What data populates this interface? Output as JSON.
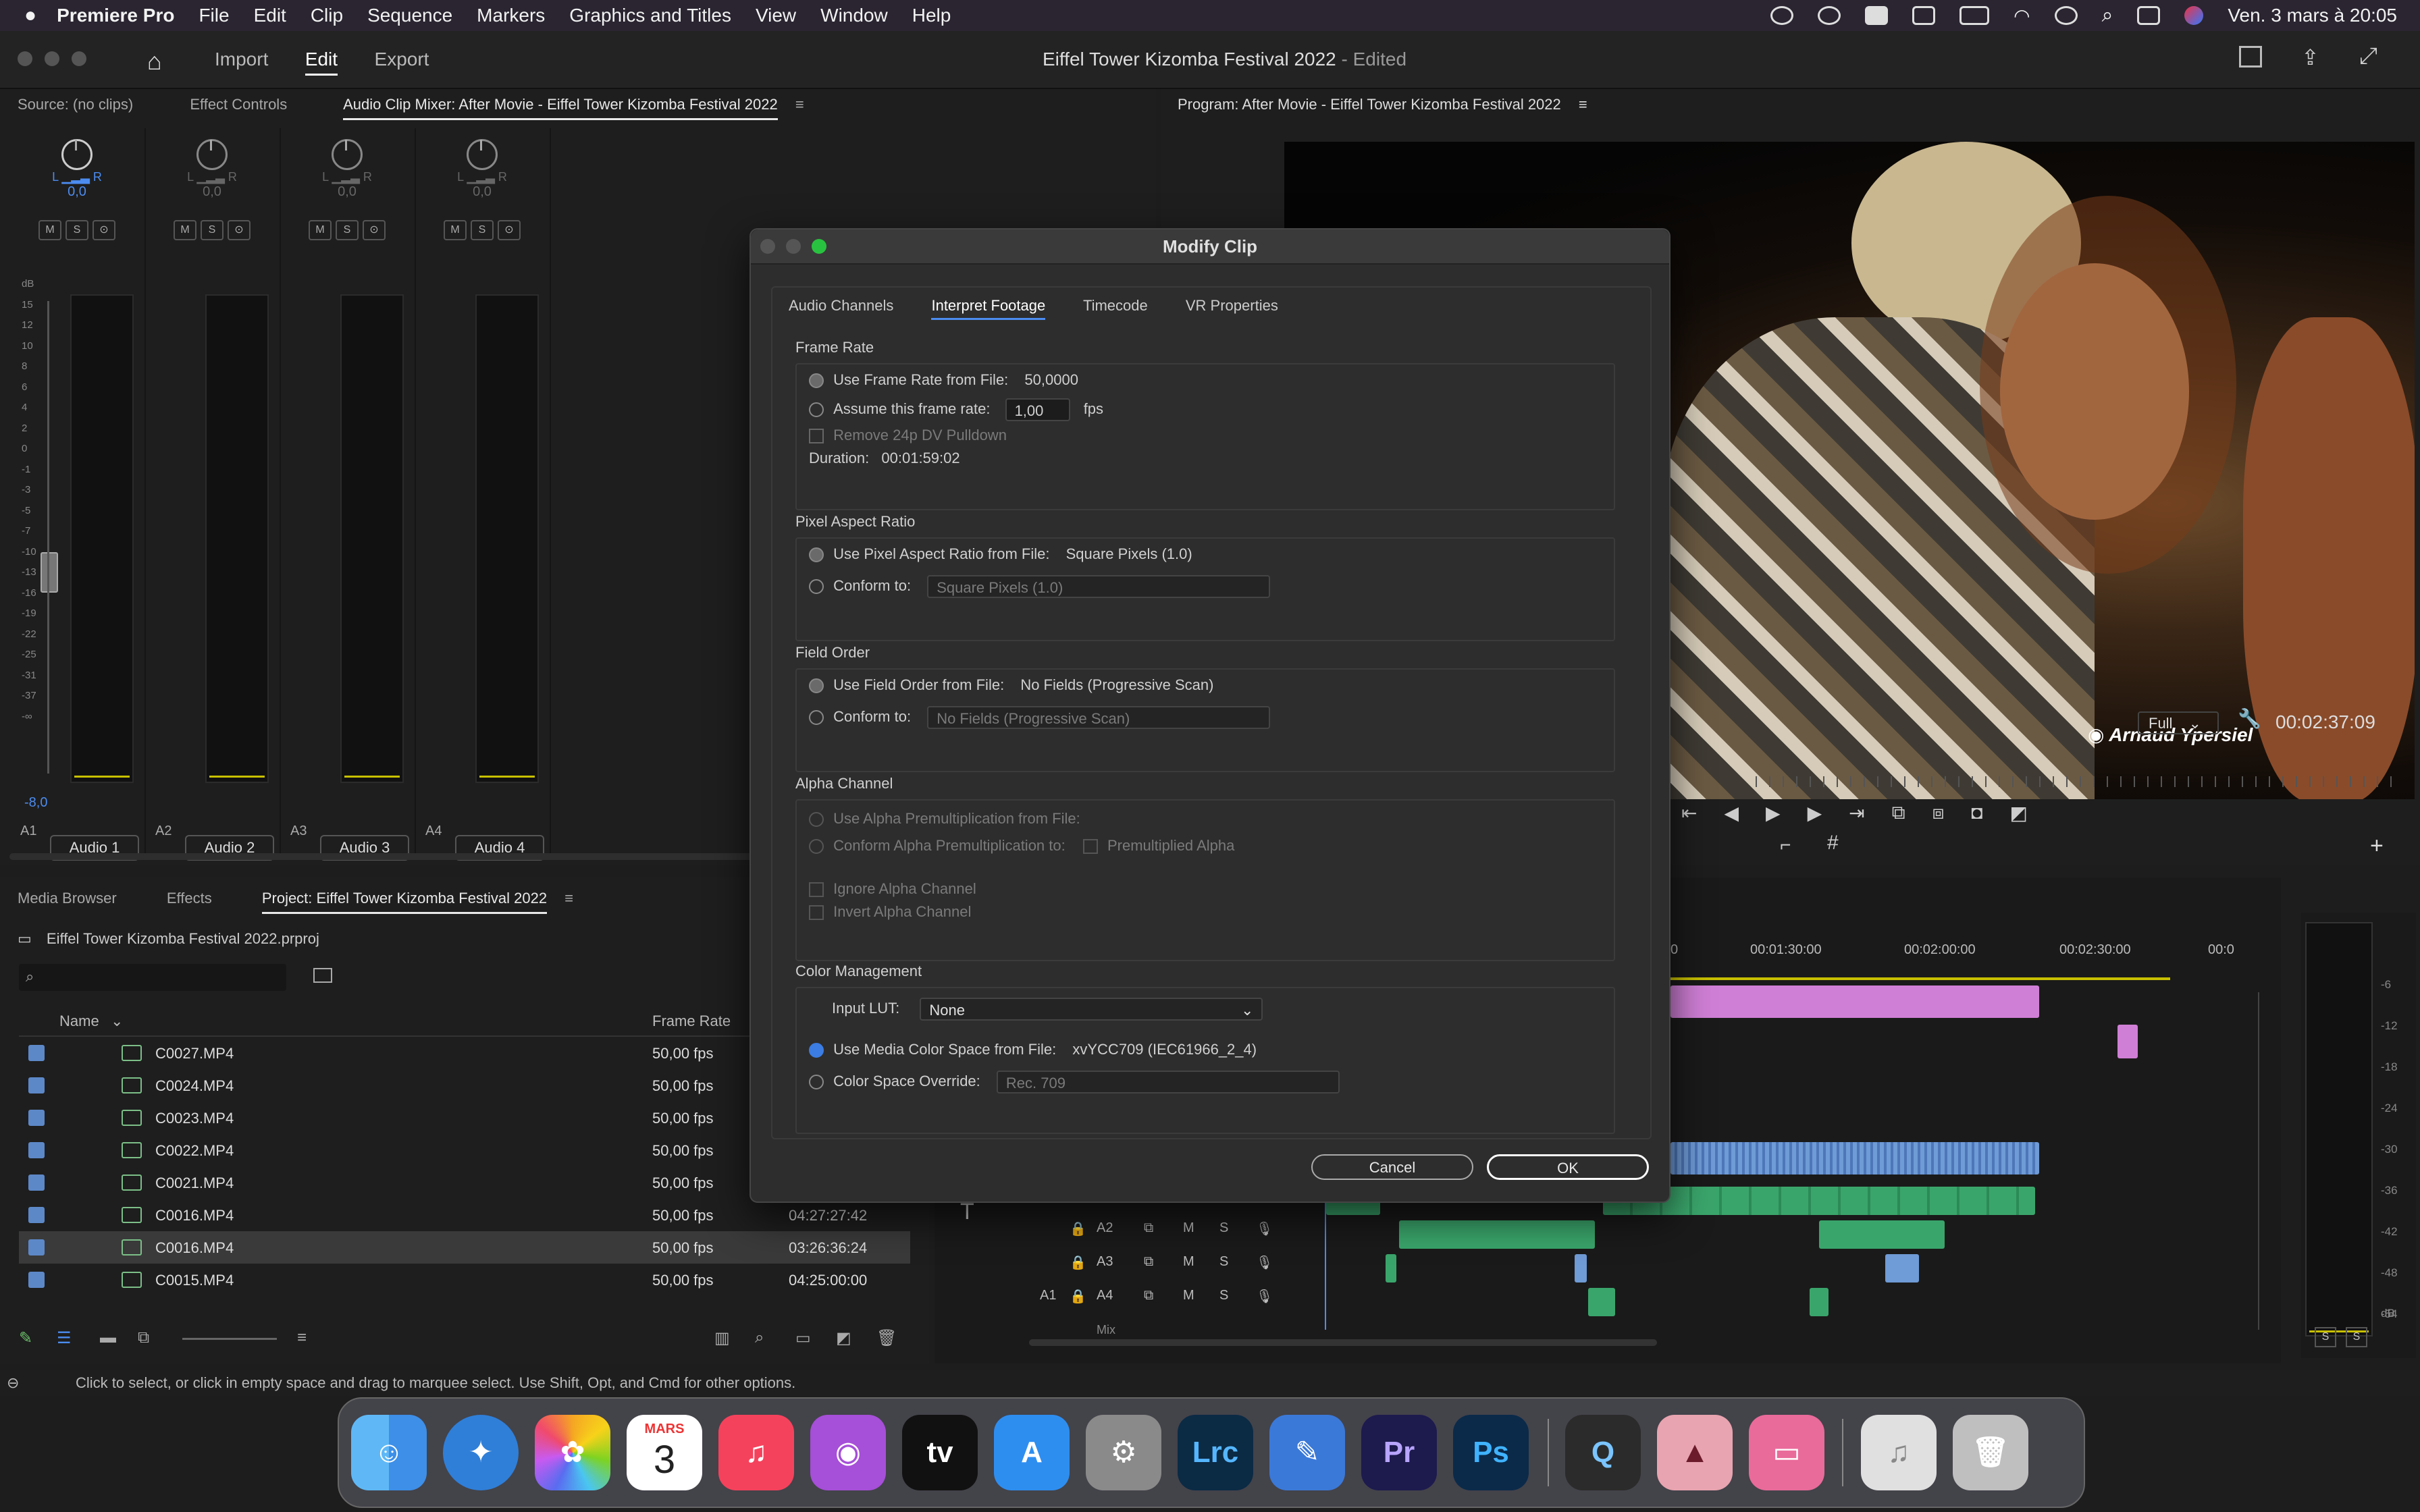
{
  "menubar": {
    "app_name": "Premiere Pro",
    "items": [
      "File",
      "Edit",
      "Clip",
      "Sequence",
      "Markers",
      "Graphics and Titles",
      "View",
      "Window",
      "Help"
    ],
    "clock": "Ven. 3 mars à 20:05"
  },
  "header": {
    "workspaces": [
      "Import",
      "Edit",
      "Export"
    ],
    "active_workspace": "Edit",
    "project_title": "Eiffel Tower Kizomba Festival 2022",
    "edited_suffix": " - Edited"
  },
  "source_panel": {
    "tabs": [
      "Source: (no clips)",
      "Effect Controls",
      "Audio Clip Mixer: After Movie - Eiffel Tower Kizomba Festival 2022"
    ],
    "channels": [
      {
        "id": "A1",
        "name": "Audio 1",
        "pan": "0,0",
        "level": "-8,0"
      },
      {
        "id": "A2",
        "name": "Audio 2",
        "pan": "0,0",
        "level": ""
      },
      {
        "id": "A3",
        "name": "Audio 3",
        "pan": "0,0",
        "level": ""
      },
      {
        "id": "A4",
        "name": "Audio 4",
        "pan": "0,0",
        "level": ""
      }
    ],
    "msb": [
      "M",
      "S",
      "⊙"
    ],
    "db_scale": [
      "dB",
      "15",
      "12",
      "10",
      "8",
      "6",
      "4",
      "2",
      "0",
      "-1",
      "-3",
      "-5",
      "-7",
      "-10",
      "-13",
      "-16",
      "-19",
      "-22",
      "-25",
      "-31",
      "-37",
      "-∞"
    ]
  },
  "program_panel": {
    "title": "Program: After Movie - Eiffel Tower Kizomba Festival 2022",
    "watermark": "Arnaud Ypersiel",
    "zoom": "Full",
    "timecode": "00:02:37:09"
  },
  "project_panel": {
    "tabs": [
      "Media Browser",
      "Effects",
      "Project: Eiffel Tower Kizomba Festival 2022"
    ],
    "file": "Eiffel Tower Kizomba Festival 2022.prproj",
    "columns": {
      "name": "Name",
      "frame_rate": "Frame Rate"
    },
    "rows": [
      {
        "name": "C0027.MP4",
        "fps": "50,00 fps",
        "dur": ""
      },
      {
        "name": "C0024.MP4",
        "fps": "50,00 fps",
        "dur": ""
      },
      {
        "name": "C0023.MP4",
        "fps": "50,00 fps",
        "dur": ""
      },
      {
        "name": "C0022.MP4",
        "fps": "50,00 fps",
        "dur": ""
      },
      {
        "name": "C0021.MP4",
        "fps": "50,00 fps",
        "dur": ""
      },
      {
        "name": "C0016.MP4",
        "fps": "50,00 fps",
        "dur": "04:27:27:42"
      },
      {
        "name": "C0016.MP4",
        "fps": "50,00 fps",
        "dur": "03:26:36:24"
      },
      {
        "name": "C0015.MP4",
        "fps": "50,00 fps",
        "dur": "04:25:00:00"
      }
    ]
  },
  "timeline": {
    "ruler": [
      "0",
      "00:01:30:00",
      "00:02:00:00",
      "00:02:30:00",
      "00:0"
    ],
    "tracks": [
      {
        "id": "A2",
        "m": "M",
        "s": "S"
      },
      {
        "id": "A3",
        "m": "M",
        "s": "S"
      },
      {
        "id": "A4",
        "m": "M",
        "s": "S",
        "src": "A1"
      }
    ],
    "mix_label": "Mix",
    "meter_scale": [
      "-6",
      "-12",
      "-18",
      "-24",
      "-30",
      "-36",
      "-42",
      "-48",
      "-54",
      "dB"
    ],
    "solo": [
      "S",
      "S"
    ]
  },
  "modal": {
    "title": "Modify Clip",
    "tabs": [
      "Audio Channels",
      "Interpret Footage",
      "Timecode",
      "VR Properties"
    ],
    "active_tab": "Interpret Footage",
    "frame_rate": {
      "heading": "Frame Rate",
      "use_from_file": "Use Frame Rate from File:",
      "file_rate": "50,0000",
      "assume": "Assume this frame rate:",
      "assume_value": "1,00",
      "fps": "fps",
      "pulldown": "Remove 24p DV Pulldown",
      "duration_label": "Duration:",
      "duration": "00:01:59:02"
    },
    "pixel_aspect": {
      "heading": "Pixel Aspect Ratio",
      "use_from_file": "Use Pixel Aspect Ratio from File:",
      "file_value": "Square Pixels (1.0)",
      "conform": "Conform to:",
      "conform_value": "Square Pixels (1.0)"
    },
    "field_order": {
      "heading": "Field Order",
      "use_from_file": "Use Field Order from File:",
      "file_value": "No Fields (Progressive Scan)",
      "conform": "Conform to:",
      "conform_value": "No Fields (Progressive Scan)"
    },
    "alpha": {
      "heading": "Alpha Channel",
      "use_premult": "Use Alpha Premultiplication from File:",
      "conform_premult": "Conform Alpha Premultiplication to:",
      "premult_alpha": "Premultiplied Alpha",
      "ignore": "Ignore Alpha Channel",
      "invert": "Invert Alpha Channel"
    },
    "color": {
      "heading": "Color Management",
      "lut_label": "Input LUT:",
      "lut_value": "None",
      "use_media": "Use Media Color Space from File:",
      "media_value": "xvYCC709 (IEC61966_2_4)",
      "override": "Color Space Override:",
      "override_value": "Rec. 709"
    },
    "cancel": "Cancel",
    "ok": "OK"
  },
  "status_bar": "Click to select, or click in empty space and drag to marquee select. Use Shift, Opt, and Cmd for other options.",
  "dock": {
    "calendar_month": "MARS",
    "calendar_day": "3",
    "apps": [
      {
        "name": "finder",
        "label": "",
        "color": "#3d8fe8"
      },
      {
        "name": "safari",
        "label": "",
        "color": "#2f7fd8"
      },
      {
        "name": "photos",
        "label": "",
        "color": "#f3f3f3"
      },
      {
        "name": "calendar",
        "label": "",
        "color": "#ffffff"
      },
      {
        "name": "music",
        "label": "♫",
        "color": "#f5425c"
      },
      {
        "name": "podcasts",
        "label": "◉",
        "color": "#a64fd8"
      },
      {
        "name": "apple-tv",
        "label": "tv",
        "color": "#111111"
      },
      {
        "name": "app-store",
        "label": "A",
        "color": "#2e8ef0"
      },
      {
        "name": "system-settings",
        "label": "⚙",
        "color": "#8a8a8a"
      },
      {
        "name": "lightroom-classic",
        "label": "Lrc",
        "color": "#0b2a44"
      },
      {
        "name": "pages",
        "label": "✎",
        "color": "#3b79d8"
      },
      {
        "name": "premiere-pro",
        "label": "Pr",
        "color": "#1d1a4e"
      },
      {
        "name": "photoshop",
        "label": "Ps",
        "color": "#0b2a4a"
      },
      {
        "name": "quicktime",
        "label": "Q",
        "color": "#2b2b2b"
      },
      {
        "name": "affinity",
        "label": "▲",
        "color": "#e8a4b0"
      },
      {
        "name": "cleanmymac",
        "label": "▭",
        "color": "#e96b9a"
      },
      {
        "name": "music-file",
        "label": "♫",
        "color": "#e0e0e0"
      },
      {
        "name": "trash",
        "label": "🗑",
        "color": "#bfbfbf"
      }
    ]
  }
}
